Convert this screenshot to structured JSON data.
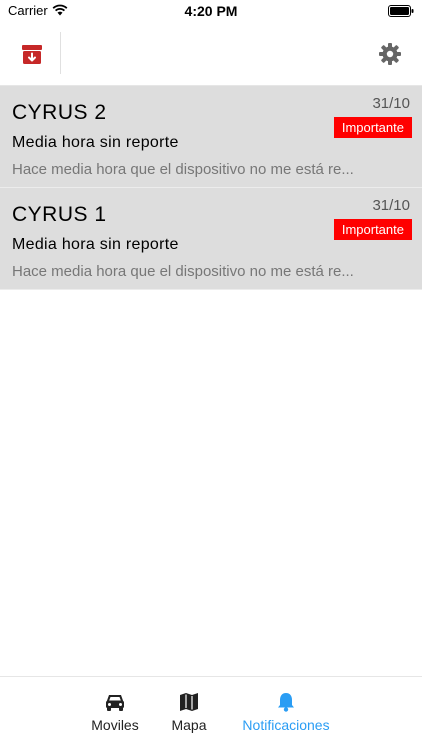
{
  "status": {
    "carrier": "Carrier",
    "time": "4:20 PM"
  },
  "topbar": {
    "archive_icon": "archive-icon",
    "settings_icon": "gear-icon"
  },
  "notifications": [
    {
      "title": "CYRUS 2",
      "date": "31/10",
      "badge": "Importante",
      "subtitle": "Media hora sin reporte",
      "message": "Hace media hora que el dispositivo no me está re..."
    },
    {
      "title": "CYRUS 1",
      "date": "31/10",
      "badge": "Importante",
      "subtitle": "Media hora sin reporte",
      "message": "Hace media hora que el dispositivo no me está re..."
    }
  ],
  "tabs": [
    {
      "label": "Moviles",
      "icon": "car-icon"
    },
    {
      "label": "Mapa",
      "icon": "map-icon"
    },
    {
      "label": "Notificaciones",
      "icon": "bell-icon",
      "active": true
    }
  ],
  "colors": {
    "accent": "#2a9df4",
    "badge": "#ff0000",
    "archive": "#c62828",
    "item_bg": "#dddddd"
  }
}
